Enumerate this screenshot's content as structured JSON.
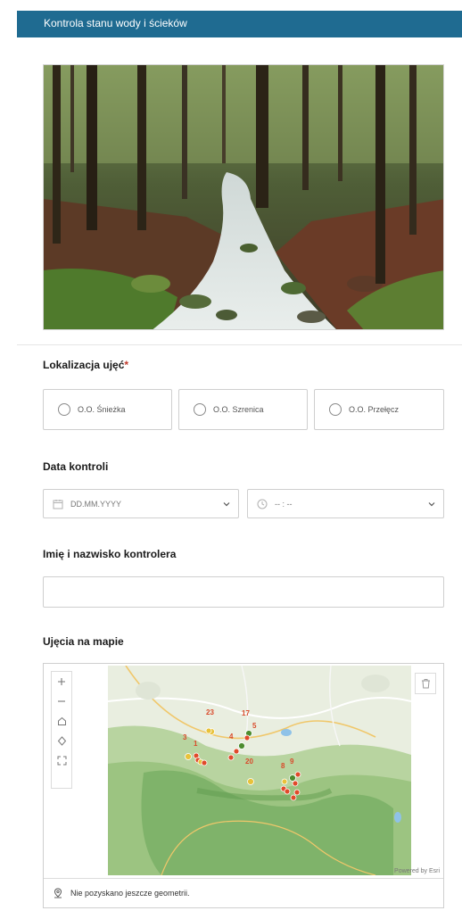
{
  "form": {
    "title": "Kontrola stanu wody i ścieków"
  },
  "location": {
    "label": "Lokalizacja ujęć",
    "required_mark": "*",
    "options": [
      "O.O. Śnieżka",
      "O.O. Szrenica",
      "O.O. Przełęcz"
    ]
  },
  "inspection_date": {
    "label": "Data kontroli",
    "date_placeholder": "DD.MM.YYYY",
    "time_placeholder": "-- : --"
  },
  "inspector": {
    "label": "Imię i nazwisko kontrolera",
    "value": ""
  },
  "map": {
    "label": "Ujęcia na mapie",
    "tools": [
      "zoom-in",
      "zoom-out",
      "home",
      "locate",
      "fullscreen"
    ],
    "attribution": "Powered by Esri",
    "status": "Nie pozyskano jeszcze geometrii.",
    "marker_labels": [
      "23",
      "17",
      "5",
      "3",
      "1",
      "4",
      "20",
      "8",
      "9"
    ]
  }
}
